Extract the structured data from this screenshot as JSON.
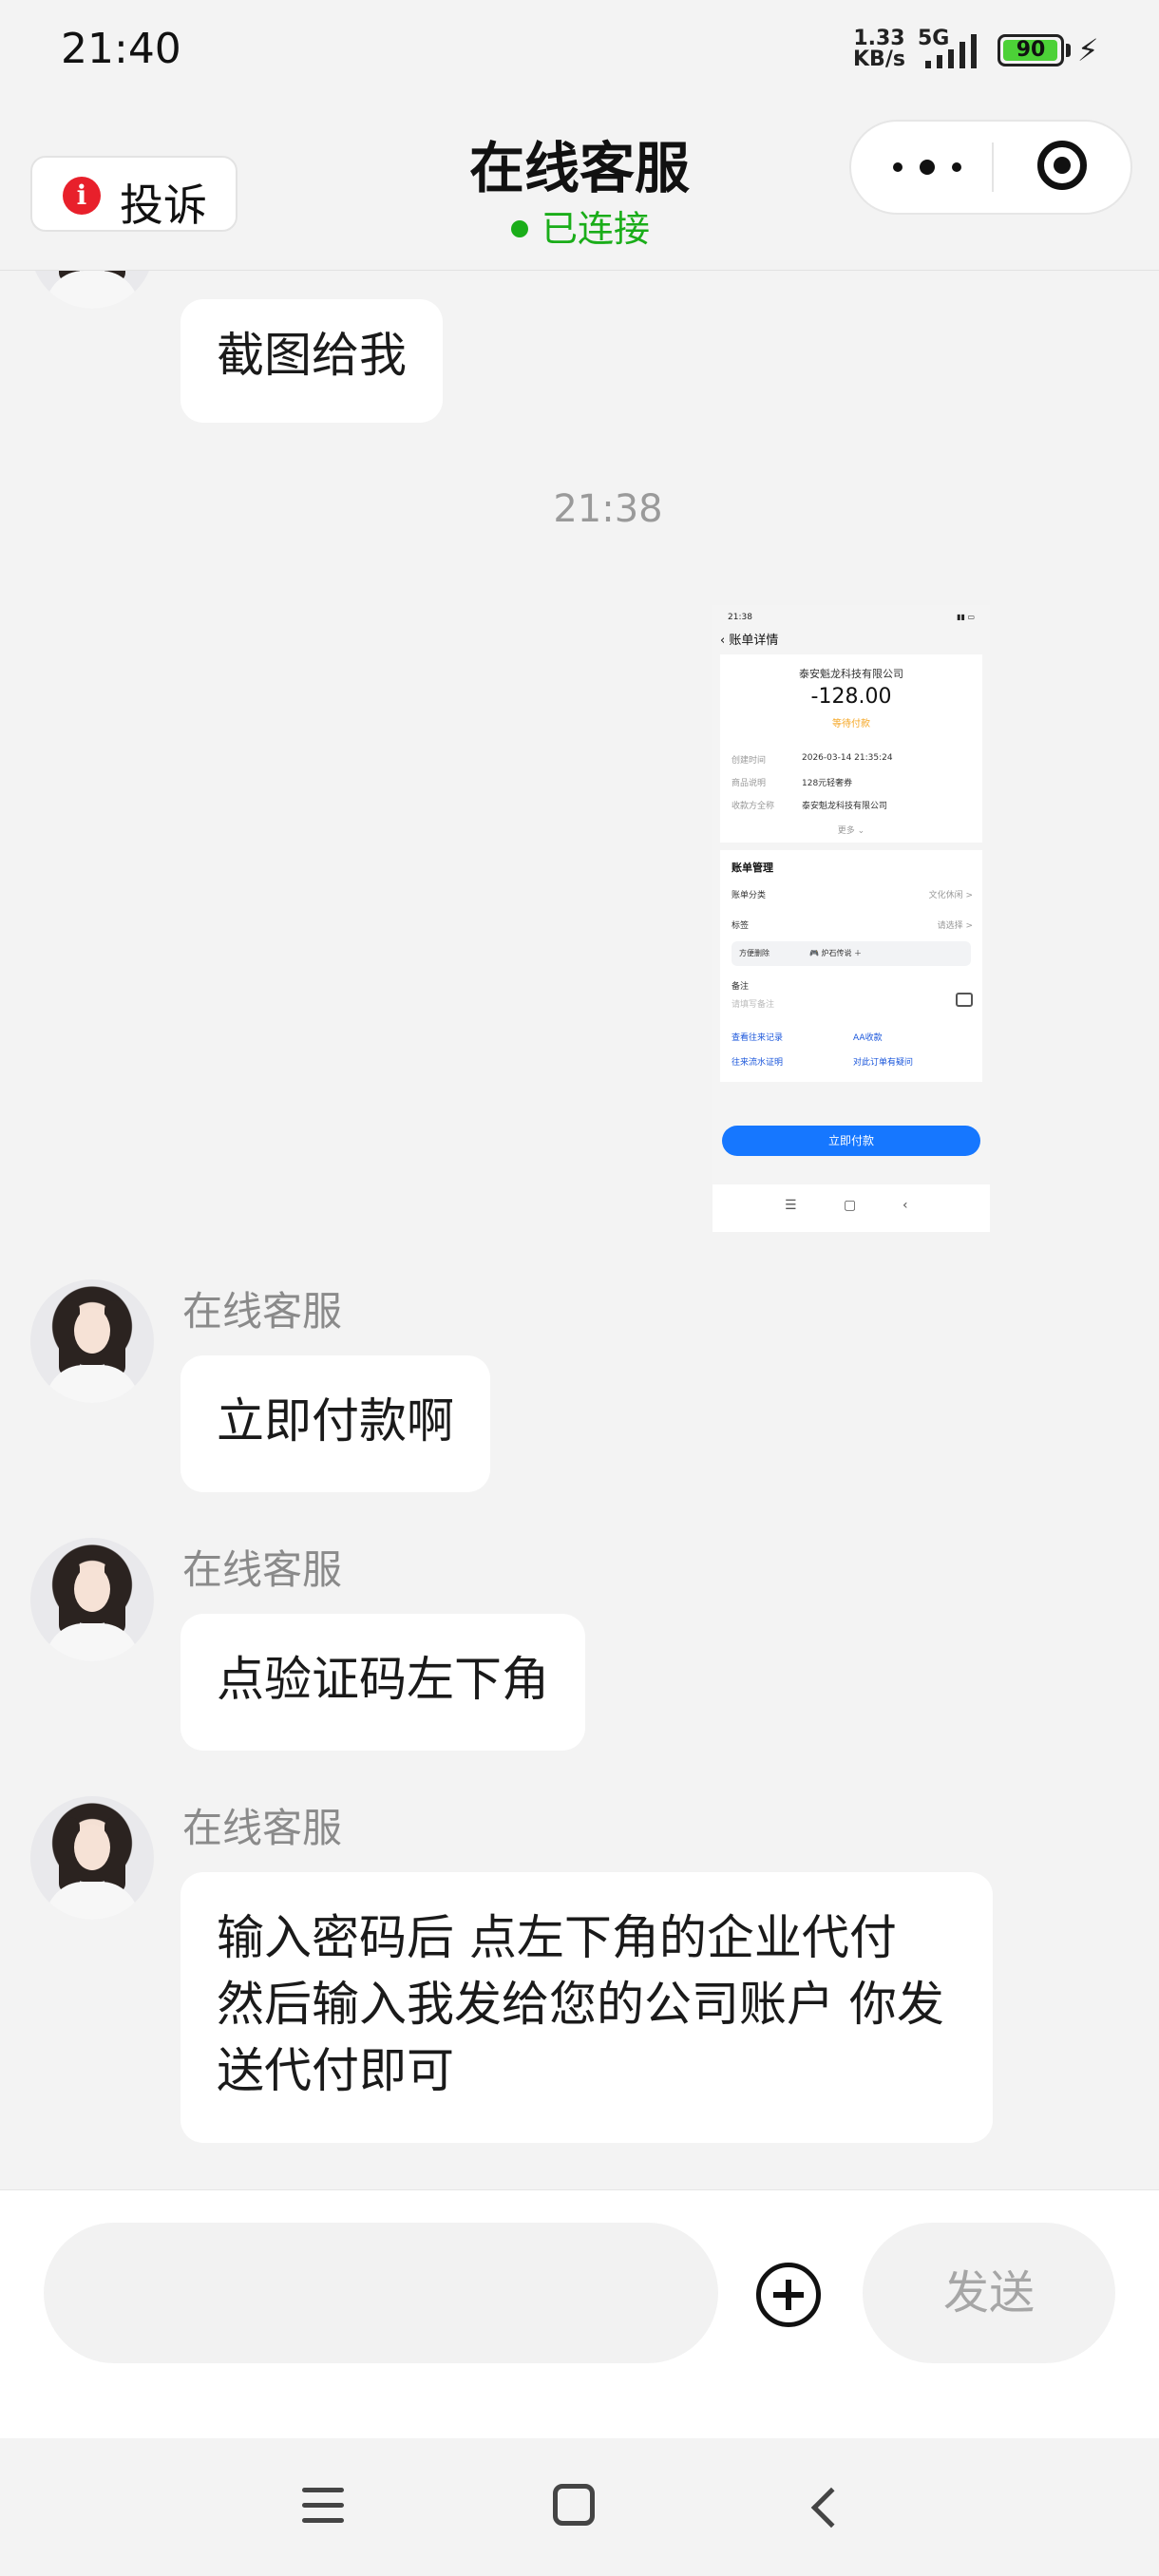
{
  "status_bar": {
    "time": "21:40",
    "speed_value": "1.33",
    "speed_unit": "KB/s",
    "network": "5G",
    "battery": "90"
  },
  "header": {
    "complain_label": "投诉",
    "title": "在线客服",
    "connection_status": "已连接"
  },
  "chat": {
    "top_bubble": "截图给我",
    "timestamp": "21:38",
    "screenshot": {
      "time": "21:38",
      "nav_title": "账单详情",
      "company": "泰安魁龙科技有限公司",
      "amount": "-128.00",
      "status": "等待付款",
      "rows": [
        {
          "label": "创建时间",
          "value": "2026-03-14 21:35:24"
        },
        {
          "label": "商品说明",
          "value": "128元轻奢券"
        },
        {
          "label": "收款方全称",
          "value": "泰安魁龙科技有限公司"
        }
      ],
      "more": "更多 ⌄",
      "manage_title": "账单管理",
      "category_label": "账单分类",
      "category_value": "文化休闲 >",
      "tag_label": "标签",
      "tag_value": "请选择 >",
      "tag1": "方便删除",
      "tag2": "🎮 炉石传说 ＋",
      "note_label": "备注",
      "note_placeholder": "请填写备注",
      "links": [
        "查看往来记录",
        "AA收款",
        "往来流水证明",
        "对此订单有疑问"
      ],
      "pay_button": "立即付款",
      "nav_icons": [
        "☰",
        "▢",
        "‹"
      ]
    },
    "messages": [
      {
        "sender": "在线客服",
        "text": "立即付款啊"
      },
      {
        "sender": "在线客服",
        "text": "点验证码左下角"
      },
      {
        "sender": "在线客服",
        "text": "输入密码后 点左下角的企业代付 然后输入我发给您的公司账户 你发送代付即可"
      }
    ]
  },
  "input_bar": {
    "placeholder": "",
    "send_label": "发送"
  },
  "icons": {
    "complain": "info-icon",
    "more": "more-dots-icon",
    "close": "target-icon",
    "attach": "plus-circle-icon"
  },
  "colors": {
    "connected": "#1aad19",
    "info": "#e8202b",
    "pay": "#1677ff"
  }
}
